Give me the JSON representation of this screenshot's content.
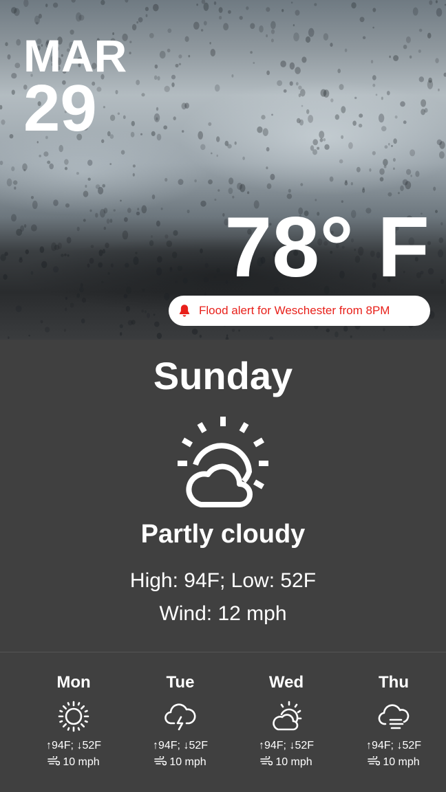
{
  "hero": {
    "month": "MAR",
    "day": "29",
    "temperature": "78° F",
    "alert": {
      "icon": "bell-icon",
      "text": "Flood alert for Weschester from 8PM",
      "color": "#e8201a"
    }
  },
  "today": {
    "day": "Sunday",
    "icon": "partly-cloudy-icon",
    "condition": "Partly cloudy",
    "high_low": "High: 94F; Low: 52F",
    "wind": "Wind: 12 mph"
  },
  "forecast": [
    {
      "day": "Mon",
      "icon": "sun-icon",
      "high_low": "↑94F; ↓52F",
      "wind": "10 mph"
    },
    {
      "day": "Tue",
      "icon": "thunderstorm-icon",
      "high_low": "↑94F; ↓52F",
      "wind": "10 mph"
    },
    {
      "day": "Wed",
      "icon": "partly-cloudy-icon",
      "high_low": "↑94F; ↓52F",
      "wind": "10 mph"
    },
    {
      "day": "Thu",
      "icon": "fog-icon",
      "high_low": "↑94F; ↓52F",
      "wind": "10 mph"
    }
  ],
  "colors": {
    "panel_background": "#404040",
    "text": "#ffffff",
    "alert_background": "#ffffff"
  }
}
